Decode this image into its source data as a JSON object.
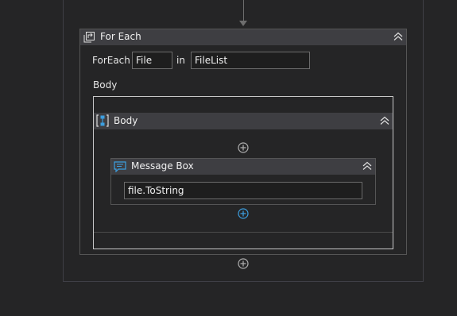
{
  "foreach": {
    "title": "For Each",
    "foreach_label": "ForEach",
    "item_value": "File",
    "in_label": "in",
    "collection_value": "FileList",
    "body_label": "Body"
  },
  "body_sequence": {
    "title": "Body"
  },
  "message_box": {
    "title": "Message Box",
    "text_value": "file.ToString"
  },
  "colors": {
    "background": "#252526",
    "header": "#3e3e42",
    "accent_blue": "#3c9fe0",
    "add_icon_gray": "#b0b0b0"
  },
  "icons": {
    "foreach": "foreach-loop-icon",
    "body": "sequence-icon",
    "message_box": "message-box-icon",
    "collapse": "collapse-chevron-icon",
    "add": "add-activity-icon"
  }
}
